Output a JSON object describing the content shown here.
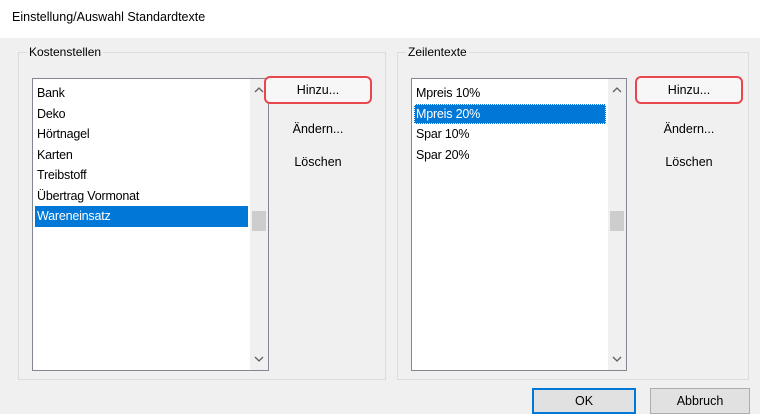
{
  "dialog": {
    "title": "Einstellung/Auswahl Standardtexte"
  },
  "kostenstellen": {
    "label": "Kostenstellen",
    "items": [
      "Bank",
      "Deko",
      "Hörtnagel",
      "Karten",
      "Treibstoff",
      "Übertrag Vormonat",
      "Wareneinsatz"
    ],
    "selected": "Wareneinsatz",
    "add_label": "Hinzu...",
    "edit_label": "Ändern...",
    "delete_label": "Löschen"
  },
  "zeilentexte": {
    "label": "Zeilentexte",
    "items": [
      "Mpreis 10%",
      "Mpreis 20%",
      "Spar 10%",
      "Spar 20%"
    ],
    "selected": "Mpreis 20%",
    "add_label": "Hinzu...",
    "edit_label": "Ändern...",
    "delete_label": "Löschen"
  },
  "buttons": {
    "ok_label": "OK",
    "cancel_label": "Abbruch"
  },
  "icons": {
    "scroll_up": "chevron-up-icon",
    "scroll_down": "chevron-down-icon"
  },
  "colors": {
    "selection": "#0078d7",
    "highlight_frame": "#e8474f"
  }
}
